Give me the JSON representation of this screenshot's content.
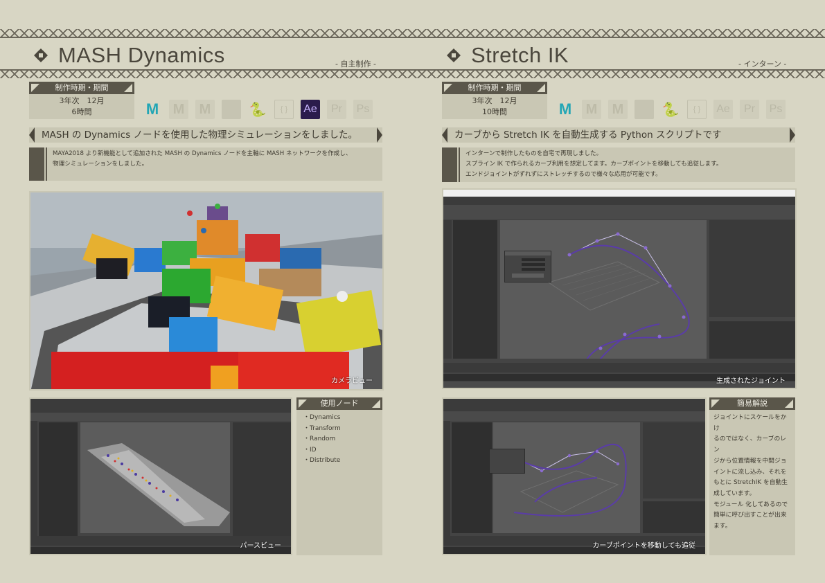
{
  "left": {
    "title": "MASH Dynamics",
    "subtitle": "- 自主制作 -",
    "period_label": "制作時期・期間",
    "period_line1": "3年次　12月",
    "period_line2": "6時間",
    "tools": [
      "maya-icon",
      "mudbox-icon-faded",
      "mudbox-icon-faded",
      "substance-icon-faded",
      "python-icon-faded",
      "json-icon-faded",
      "after-effects-icon",
      "premiere-icon-faded",
      "photoshop-icon-faded"
    ],
    "tool_labels": {
      "maya": "M",
      "mudbox": "M",
      "ae": "Ae",
      "pr": "Pr",
      "ps": "Ps",
      "json": "{ }"
    },
    "banner": "MASH の Dynamics ノードを使用した物理シミュレーションをしました。",
    "desc_line1": "MAYA2018 より新機能として追加された MASH の Dynamics ノードを主軸に MASH ネットワークを作成し、",
    "desc_line2": "物理シミュレーションをしました。",
    "photo_caption": "カメラビュー",
    "screenshot_caption": "パースビュー",
    "nodes_head": "使用ノード",
    "nodes": [
      "Dynamics",
      "Transform",
      "Random",
      "ID",
      "Distribute"
    ]
  },
  "right": {
    "title": "Stretch IK",
    "subtitle": "- インターン -",
    "period_label": "制作時期・期間",
    "period_line1": "3年次　12月",
    "period_line2": "10時間",
    "banner": "カーブから Stretch IK を自動生成する Python スクリプトです",
    "desc_line1": "インターンで制作したものを自宅で再現しました。",
    "desc_line2": "スプライン IK で作られるカーブ利用を想定してます。カーブポイントを移動しても追従します。",
    "desc_line3": "エンドジョイントがずれずにストレッチするので様々な応用が可能です。",
    "screenshot1_caption": "生成されたジョイント",
    "screenshot2_caption": "カーブポイントを移動しても追従",
    "explain_head": "簡易解説",
    "explain_lines": [
      "ジョイントにスケールをかけ",
      "るのではなく、カーブのレン",
      "ジから位置情報を中間ジョ",
      "イントに流し込み、それを",
      "もとに StretchIK を自動生",
      "成しています。",
      "モジュール 化してあるので",
      "簡単に呼び出すことが出来",
      "ます。"
    ]
  },
  "colors": {
    "background": "#d8d6c4",
    "panel": "#c9c7b4",
    "dark": "#5a564a",
    "maya_teal": "#22a6b5",
    "ae_purple": "#2b1c4c"
  }
}
